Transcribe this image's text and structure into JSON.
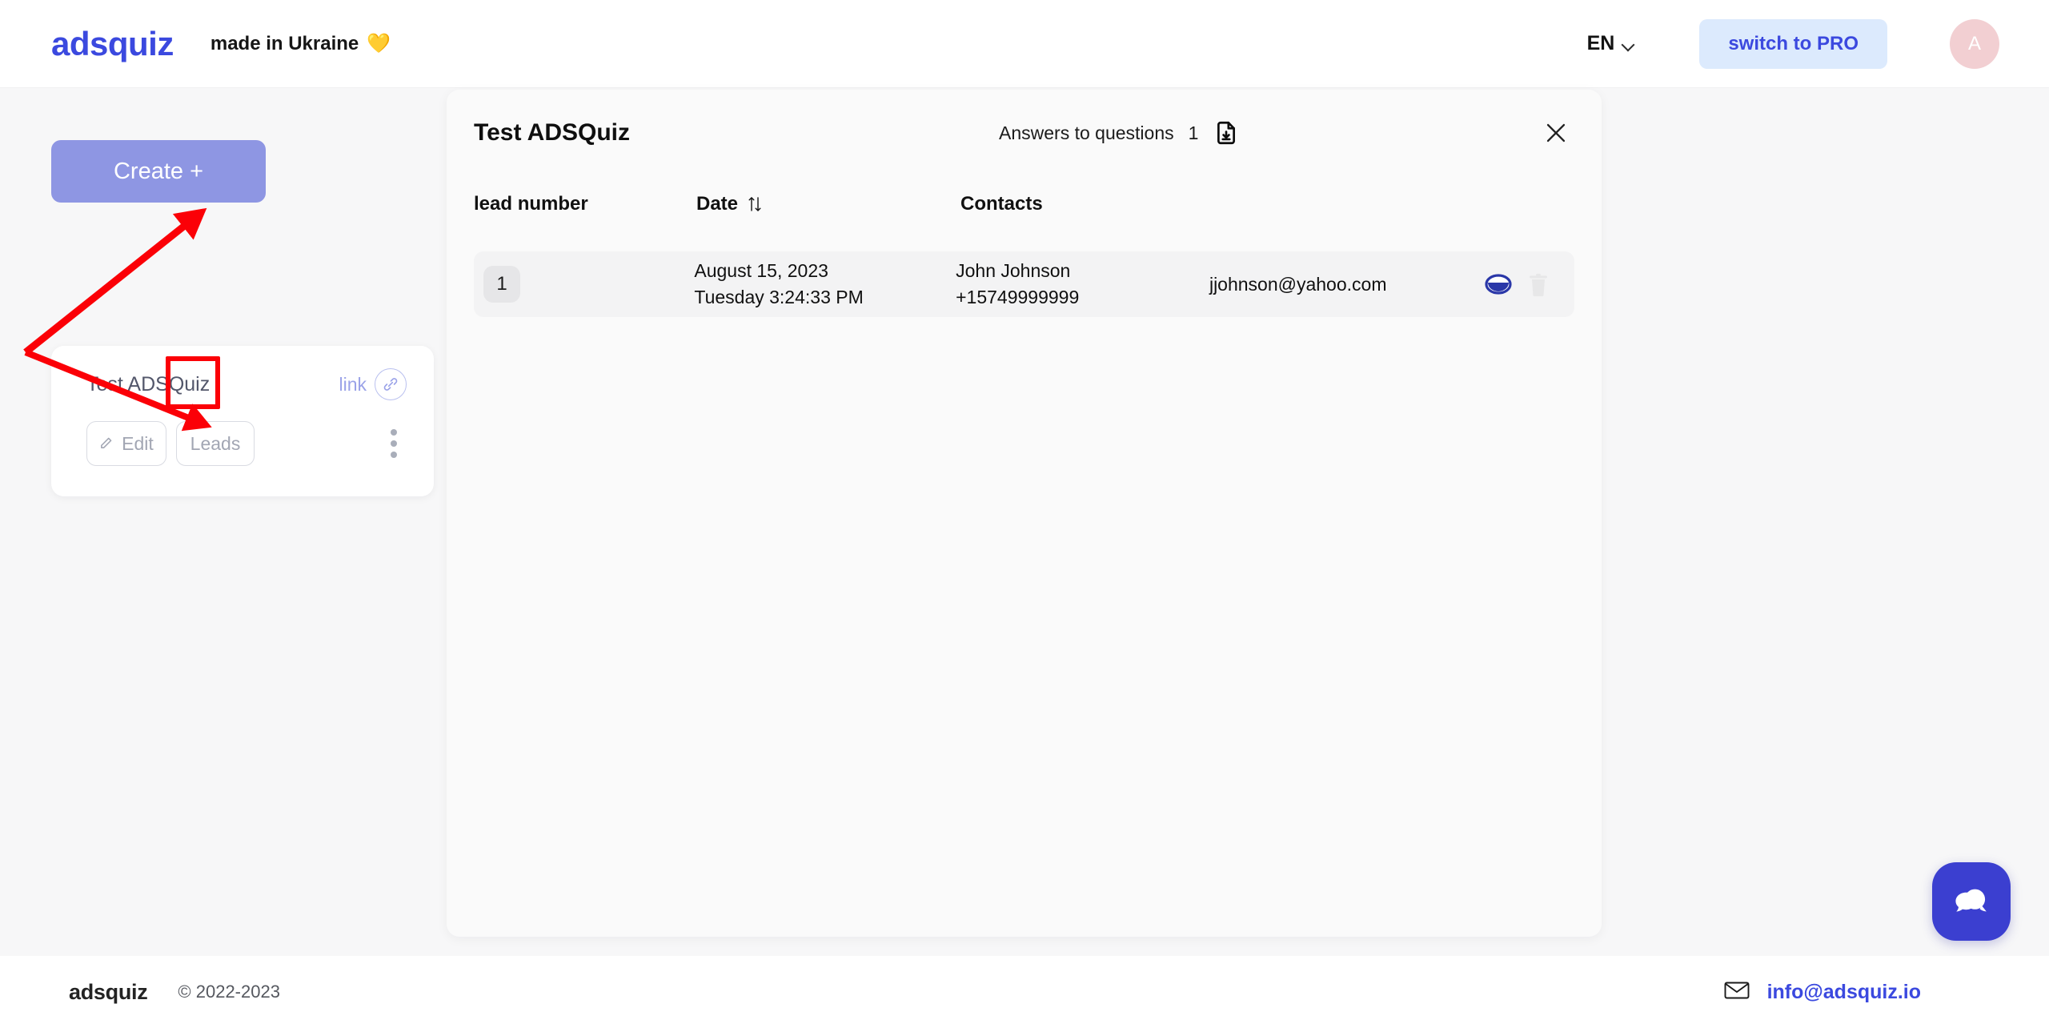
{
  "header": {
    "logo": "adsquiz",
    "tagline": "made in Ukraine",
    "heart": "💛",
    "language": "EN",
    "pro_button": "switch to PRO",
    "avatar_initial": "A"
  },
  "sidebar": {
    "create_button": "Create +",
    "quiz_card": {
      "title": "Test ADSQuiz",
      "link_label": "link",
      "edit_button": "Edit",
      "leads_button": "Leads"
    }
  },
  "panel": {
    "title": "Test ADSQuiz",
    "answers_label": "Answers to questions",
    "answers_count": "1",
    "table": {
      "headers": {
        "lead_number": "lead number",
        "date": "Date",
        "contacts": "Contacts"
      },
      "rows": [
        {
          "number": "1",
          "date": "August 15, 2023",
          "time": "Tuesday 3:24:33 PM",
          "name": "John Johnson",
          "phone": "+15749999999",
          "email": "jjohnson@yahoo.com"
        }
      ]
    }
  },
  "footer": {
    "logo": "adsquiz",
    "copyright": "© 2022-2023",
    "email": "info@adsquiz.io"
  },
  "colors": {
    "brand_blue": "#3b49df",
    "create_purple": "#8e96e3",
    "pro_bg": "#dceafd",
    "annotation_red": "#fb0007",
    "chat_blue": "#3b3fd0",
    "avatar_pink": "#f2cfd2"
  }
}
